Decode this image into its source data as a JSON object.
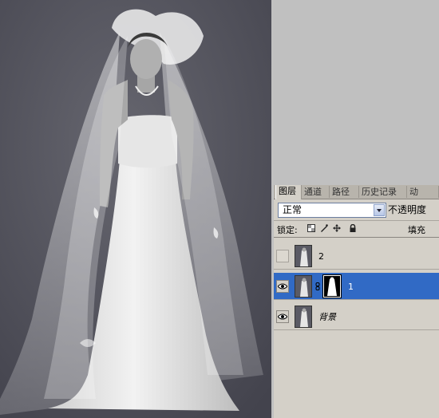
{
  "panel": {
    "tabs": [
      {
        "label": "图层"
      },
      {
        "label": "通道"
      },
      {
        "label": "路径"
      },
      {
        "label": "历史记录"
      },
      {
        "label": "动"
      }
    ],
    "blend_mode": "正常",
    "opacity_label": "不透明度",
    "lock_label": "锁定:",
    "fill_label": "填充",
    "layers": [
      {
        "name": "2",
        "visible": false,
        "selected": false,
        "has_mask": false
      },
      {
        "name": "1",
        "visible": true,
        "selected": true,
        "has_mask": true
      },
      {
        "name": "背景",
        "visible": true,
        "selected": false,
        "has_mask": false
      }
    ]
  },
  "colors": {
    "selection": "#316ac5",
    "panel_bg": "#d4d0c8",
    "workspace_bg": "#c0c0c0"
  },
  "icons": [
    "eye-icon",
    "chain-link-icon",
    "lock-transparent-icon",
    "lock-image-icon",
    "lock-position-icon",
    "lock-all-icon",
    "dropdown-arrow-icon"
  ]
}
